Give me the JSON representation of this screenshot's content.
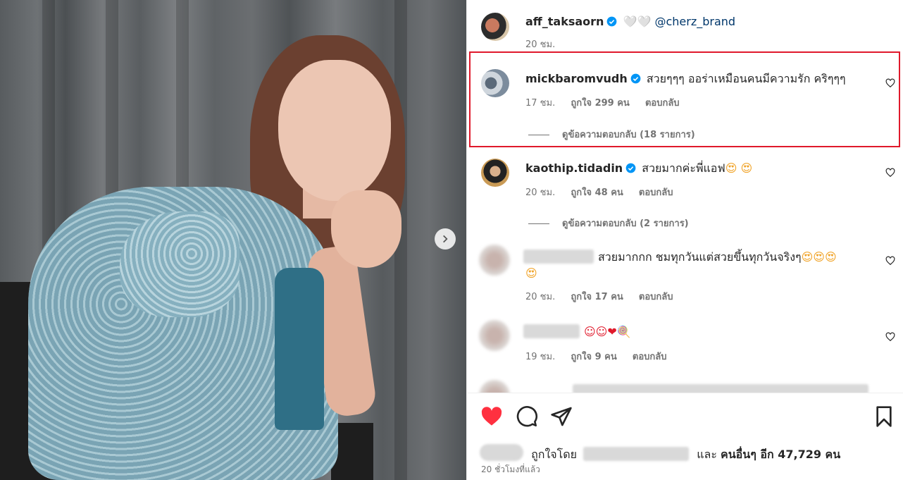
{
  "post": {
    "author": "aff_taksaorn",
    "caption_emoji": "🤍🤍",
    "caption_mention": "@cherz_brand",
    "caption_time": "20 ชม."
  },
  "comments": [
    {
      "username": "mickbaromvudh",
      "text": "สวยๆๆๆ ออร่าเหมือนคนมีความรัก คริๆๆๆ",
      "time": "17 ชม.",
      "likes": "ถูกใจ 299 คน",
      "reply": "ตอบกลับ",
      "view_replies": "ดูข้อความตอบกลับ (18 รายการ)"
    },
    {
      "username": "kaothip.tidadin",
      "text": "สวยมากค่ะพี่แอฟ",
      "emojis": "😍 😍",
      "time": "20 ชม.",
      "likes": "ถูกใจ 48 คน",
      "reply": "ตอบกลับ",
      "view_replies": "ดูข้อความตอบกลับ (2 รายการ)"
    },
    {
      "text": "สวยมากกก ชมทุกวันแต่สวยขึ้นทุกวันจริงๆ",
      "emojis": "😍😍😍",
      "emojis_line2": "😍",
      "time": "20 ชม.",
      "likes": "ถูกใจ 17 คน",
      "reply": "ตอบกลับ"
    },
    {
      "emojis": "☺☺❤🍭",
      "time": "19 ชม.",
      "likes": "ถูกใจ 9 คน",
      "reply": "ตอบกลับ"
    }
  ],
  "footer": {
    "liked_by_prefix": "ถูกใจโดย",
    "liked_by_suffix": "และ",
    "others": "คนอื่นๆ อีก 47,729 คน",
    "posted_ago": "20 ชั่วโมงที่แล้ว"
  },
  "colors": {
    "verified": "#0095f6",
    "like_red": "#ff3040",
    "highlight": "#e0192b"
  }
}
